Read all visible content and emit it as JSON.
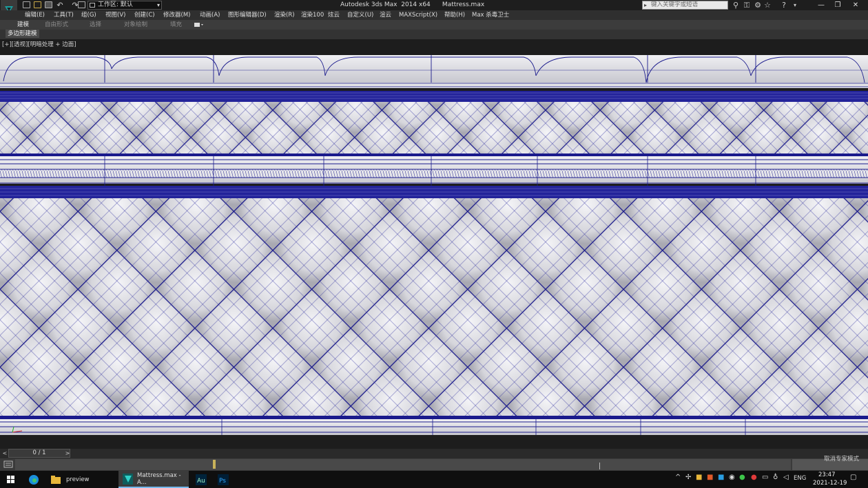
{
  "titlebar": {
    "workspace_label": "工作区: 默认",
    "title": "Autodesk 3ds Max  2014 x64      Mattress.max",
    "search_placeholder": "键入关键字或短语",
    "window_controls": [
      "—",
      "❐",
      "✕"
    ],
    "quick_access_icons": [
      "new-icon",
      "open-icon",
      "save-icon",
      "undo-icon",
      "redo-icon",
      "project-icon"
    ],
    "toolbar_icons": [
      "binoculars-icon",
      "key-icon",
      "communication-icon",
      "star-icon",
      "help-icon"
    ]
  },
  "menu": {
    "items": [
      "编辑(E)",
      "工具(T)",
      "组(G)",
      "视图(V)",
      "创建(C)",
      "修改器(M)",
      "动画(A)",
      "图形编辑器(D)",
      "渲染(R)",
      "渲染100",
      "炫云",
      "自定义(U)",
      "渲云",
      "MAXScript(X)",
      "帮助(H)",
      "Max 杀毒卫士"
    ]
  },
  "ribbon": {
    "tabs": [
      "建模",
      "自由形式",
      "选择",
      "对象绘制",
      "填充"
    ],
    "active_tab": "建模",
    "panel_tag": "多边形建模"
  },
  "viewport": {
    "label": "[+][透视][明暗处理 + 边面]",
    "wire_color": "#1a1a8c",
    "surface_color": "#d9d9de"
  },
  "timeline": {
    "frame_counter": "0 / 1",
    "prev": "<",
    "next": ">",
    "status_text": "取消专家模式"
  },
  "taskbar": {
    "items": [
      {
        "label": "preview",
        "icon": "folder-icon"
      },
      {
        "label": "Mattress.max - A...",
        "icon": "3dsmax-icon"
      },
      {
        "label": "",
        "icon": "audition-icon"
      },
      {
        "label": "",
        "icon": "photoshop-icon"
      }
    ],
    "ime": "ENG",
    "time": "23:47",
    "date": "2021-12-19"
  }
}
